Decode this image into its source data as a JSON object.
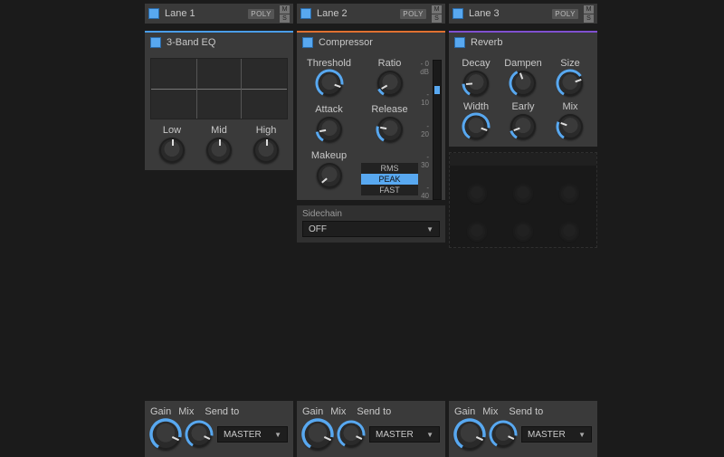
{
  "accent_colors": {
    "lane1": "#4a9de8",
    "lane2": "#e07030",
    "lane3": "#8050d0"
  },
  "lanes": [
    {
      "title": "Lane 1",
      "poly": "POLY",
      "m": "M",
      "s": "S"
    },
    {
      "title": "Lane 2",
      "poly": "POLY",
      "m": "M",
      "s": "S"
    },
    {
      "title": "Lane 3",
      "poly": "POLY",
      "m": "M",
      "s": "S"
    }
  ],
  "eq": {
    "title": "3-Band EQ",
    "knobs": {
      "low": "Low",
      "mid": "Mid",
      "high": "High"
    }
  },
  "compressor": {
    "title": "Compressor",
    "labels": {
      "threshold": "Threshold",
      "ratio": "Ratio",
      "attack": "Attack",
      "release": "Release",
      "makeup": "Makeup"
    },
    "modes": [
      "RMS",
      "PEAK",
      "FAST"
    ],
    "mode_selected": "PEAK",
    "meter_ticks": [
      "- 0 dB",
      "- 10",
      "- 20",
      "- 30",
      "- 40"
    ],
    "meter_fill_pct_top": 18,
    "meter_fill_pct_height": 6,
    "sidechain": {
      "label": "Sidechain",
      "value": "OFF"
    }
  },
  "reverb": {
    "title": "Reverb",
    "labels": {
      "decay": "Decay",
      "dampen": "Dampen",
      "size": "Size",
      "width": "Width",
      "early": "Early",
      "mix": "Mix"
    }
  },
  "footer": {
    "gain": "Gain",
    "mix": "Mix",
    "sendto": "Send to",
    "dest": "MASTER"
  }
}
